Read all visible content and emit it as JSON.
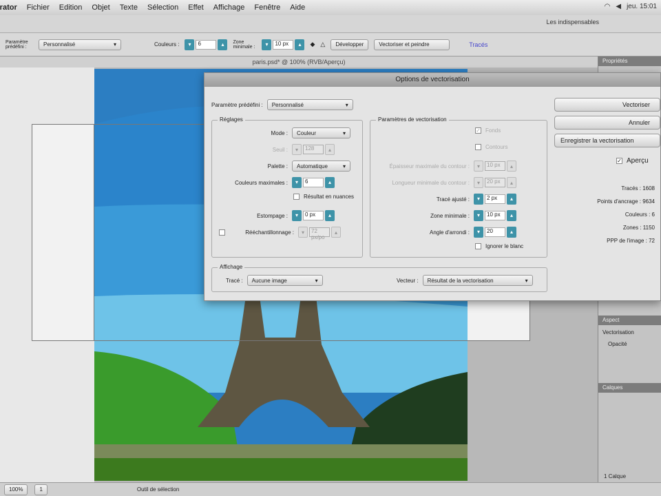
{
  "menu": [
    "Illustrator",
    "Fichier",
    "Edition",
    "Objet",
    "Texte",
    "Sélection",
    "Effet",
    "Affichage",
    "Fenêtre",
    "Aide"
  ],
  "menu_status": "jeu. 15:01",
  "workspace": "Les indispensables",
  "control": {
    "preset_label": "Paramètre prédéfini :",
    "preset": "Personnalisé",
    "colors_label": "Couleurs :",
    "colors": "6",
    "min_area_label": "Zone minimale :",
    "min_area": "10 px",
    "expand": "Développer",
    "live_paint": "Vectoriser et peindre",
    "link": "Tracés"
  },
  "doc_tab": "paris.psd* @ 100% (RVB/Aperçu)",
  "dialog": {
    "title": "Options de vectorisation",
    "preset_label": "Paramètre prédéfini :",
    "preset": "Personnalisé",
    "adjust": {
      "title": "Réglages",
      "mode_label": "Mode :",
      "mode": "Couleur",
      "threshold_label": "Seuil :",
      "threshold": "128",
      "palette_label": "Palette :",
      "palette": "Automatique",
      "maxcolors_label": "Couleurs maximales :",
      "maxcolors": "6",
      "swatches": "Résultat en nuances",
      "blur_label": "Estompage :",
      "blur": "0 px",
      "resample_label": "Rééchantillonnage :",
      "resample": "72 px/po"
    },
    "trace": {
      "title": "Paramètres de vectorisation",
      "fills": "Fonds",
      "strokes": "Contours",
      "maxstroke_label": "Épaisseur maximale du contour :",
      "maxstroke": "10 px",
      "minstroke_label": "Longueur minimale du contour :",
      "minstroke": "20 px",
      "path_fit_label": "Tracé ajusté :",
      "path_fit": "2 px",
      "min_area_label": "Zone minimale :",
      "min_area": "10 px",
      "corner_label": "Angle d'arrondi :",
      "corner": "20",
      "ignore_white": "Ignorer le blanc"
    },
    "view": {
      "title": "Affichage",
      "raster_label": "Tracé :",
      "raster": "Aucune image",
      "vector_label": "Vecteur :",
      "vector": "Résultat de la vectorisation"
    },
    "buttons": {
      "trace": "Vectoriser",
      "cancel": "Annuler",
      "save": "Enregistrer la vectorisation"
    },
    "preview": "Aperçu",
    "stats": [
      "Tracés : 1608",
      "Points d'ancrage : 9634",
      "Couleurs : 6",
      "Zones : 1150",
      "PPP de l'image : 72"
    ]
  },
  "panel": {
    "tab1": "Propriétés",
    "tab2": "Calques",
    "layers_tab": "Aspect",
    "item": "Vectorisation",
    "opacity": "Opacité",
    "layers": "Calques",
    "footer": "1 Calque"
  },
  "status": {
    "zoom": "100%",
    "page": "1",
    "tool": "Outil de sélection"
  }
}
